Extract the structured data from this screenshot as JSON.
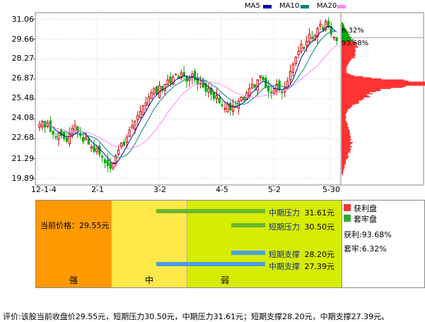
{
  "legend": [
    {
      "label": "MA5",
      "color": "#0000aa"
    },
    {
      "label": "MA10",
      "color": "#008080"
    },
    {
      "label": "MA20",
      "color": "#ff88ff"
    }
  ],
  "chart_data": {
    "type": "candlestick",
    "y_ticks": [
      "31.06",
      "29.66",
      "28.27",
      "26.87",
      "25.48",
      "24.08",
      "22.68",
      "21.29",
      "19.89"
    ],
    "ylim": [
      19.89,
      31.06
    ],
    "x_ticks": [
      "12-1-4",
      "2-1",
      "3-2",
      "4-5",
      "5-2",
      "5-30"
    ],
    "up_color": "#cc0000",
    "down_color": "#00aa00",
    "closes": [
      23.7,
      23.9,
      23.5,
      23.8,
      23.2,
      23.0,
      22.8,
      23.1,
      22.9,
      22.7,
      22.5,
      23.0,
      23.4,
      23.6,
      23.2,
      22.9,
      22.5,
      22.8,
      22.3,
      22.1,
      21.8,
      22.0,
      21.6,
      21.4,
      21.0,
      20.8,
      20.6,
      21.0,
      21.5,
      21.9,
      22.4,
      22.2,
      22.8,
      23.3,
      23.6,
      23.9,
      24.3,
      24.6,
      25.0,
      25.2,
      25.6,
      25.9,
      26.2,
      25.8,
      26.4,
      26.1,
      26.5,
      26.8,
      26.6,
      27.0,
      27.2,
      26.9,
      27.3,
      27.1,
      26.7,
      26.9,
      27.2,
      26.8,
      26.5,
      26.6,
      26.3,
      26.0,
      26.2,
      25.8,
      25.5,
      25.7,
      25.2,
      25.0,
      24.8,
      25.1,
      24.7,
      25.0,
      24.9,
      25.3,
      25.6,
      25.4,
      25.9,
      26.2,
      26.5,
      26.3,
      26.8,
      27.1,
      26.8,
      26.3,
      26.0,
      25.9,
      26.2,
      26.5,
      26.1,
      25.9,
      26.3,
      26.7,
      27.4,
      27.9,
      28.4,
      28.8,
      29.3,
      29.0,
      29.5,
      30.0,
      29.7,
      29.9,
      30.4,
      30.7,
      30.3,
      30.9,
      30.5,
      30.0,
      29.8,
      29.55
    ],
    "chip_distribution": {
      "profit_pct": 93.68,
      "trapped_pct": 6.32
    }
  },
  "distribution_labels": {
    "trapped": "6.32%",
    "profit": "93.68%"
  },
  "panel": {
    "current_price_label": "当前价格：29.55元",
    "zones": [
      "强",
      "中",
      "弱"
    ],
    "levels": [
      {
        "name": "中期压力",
        "value": "31.61元",
        "price": 31.61
      },
      {
        "name": "短期压力",
        "value": "30.50元",
        "price": 30.5
      },
      {
        "name": "短期支撑",
        "value": "28.20元",
        "price": 28.2
      },
      {
        "name": "中期支撑",
        "value": "27.39元",
        "price": 27.39
      }
    ]
  },
  "side_legend": {
    "profit_label": "获利盘",
    "trapped_label": "套牢盘",
    "profit_stat": "获利:93.68%",
    "trapped_stat": "套牢:6.32%",
    "profit_color": "#ff3333",
    "trapped_color": "#33aa33"
  },
  "footer_text": "评价:该股当前收盘价29.55元，短期压力30.50元，中期压力31.61元；短期支撑28.20元，中期支撑27.39元。"
}
